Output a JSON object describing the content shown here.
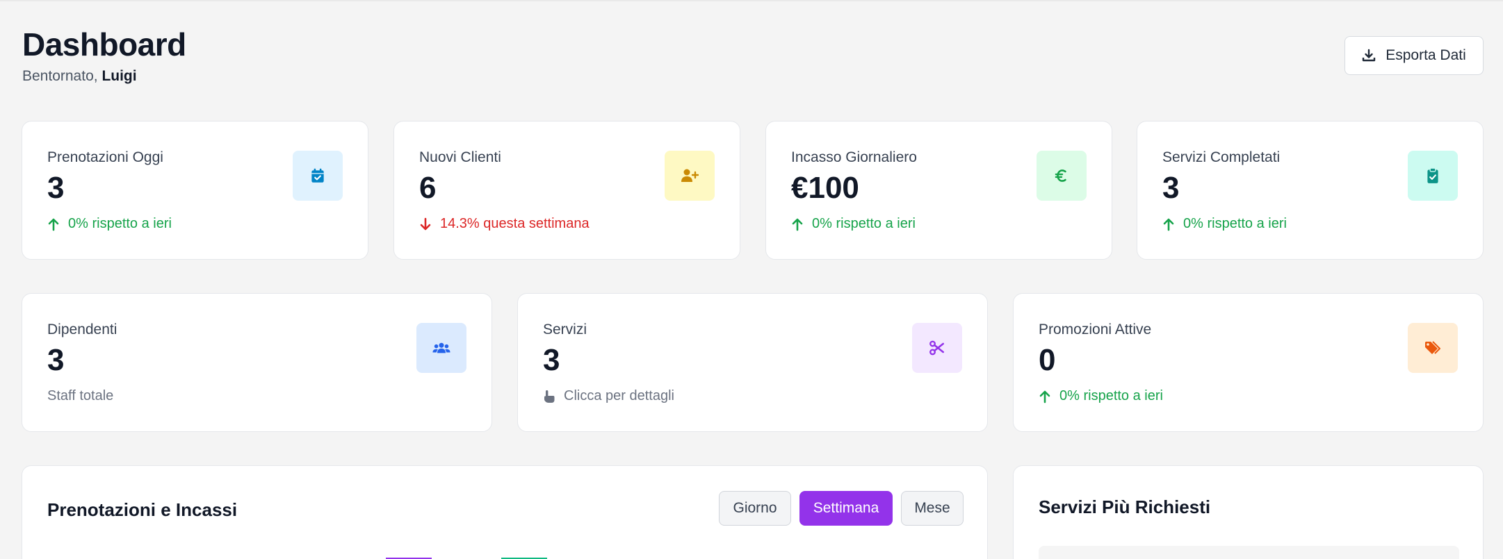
{
  "header": {
    "title": "Dashboard",
    "greeting": "Bentornato,",
    "user_name": "Luigi",
    "export_label": "Esporta Dati"
  },
  "stats_row1": [
    {
      "label": "Prenotazioni Oggi",
      "value": "3",
      "trend": "up",
      "trend_text": "0% rispetto a ieri",
      "icon": "calendar-check-icon",
      "icon_bg": "#e0f2fe",
      "icon_color": "#0284c7"
    },
    {
      "label": "Nuovi Clienti",
      "value": "6",
      "trend": "down",
      "trend_text": "14.3% questa settimana",
      "icon": "user-plus-icon",
      "icon_bg": "#fef9c3",
      "icon_color": "#ca8a04"
    },
    {
      "label": "Incasso Giornaliero",
      "value": "€100",
      "trend": "up",
      "trend_text": "0% rispetto a ieri",
      "icon": "euro-icon",
      "icon_bg": "#dcfce7",
      "icon_color": "#16a34a"
    },
    {
      "label": "Servizi Completati",
      "value": "3",
      "trend": "up",
      "trend_text": "0% rispetto a ieri",
      "icon": "clipboard-check-icon",
      "icon_bg": "#ccfbf1",
      "icon_color": "#0d9488"
    }
  ],
  "stats_row2": [
    {
      "label": "Dipendenti",
      "value": "3",
      "foot_text": "Staff totale",
      "icon": "users-icon",
      "icon_bg": "#dbeafe",
      "icon_color": "#2563eb"
    },
    {
      "label": "Servizi",
      "value": "3",
      "foot_text": "Clicca per dettagli",
      "icon": "scissors-icon",
      "icon_bg": "#f3e8ff",
      "icon_color": "#9333ea"
    },
    {
      "label": "Promozioni Attive",
      "value": "0",
      "trend": "up",
      "trend_text": "0% rispetto a ieri",
      "icon": "tags-icon",
      "icon_bg": "#ffedd5",
      "icon_color": "#ea580c"
    }
  ],
  "chart_panel": {
    "title": "Prenotazioni e Incassi",
    "periods": [
      "Giorno",
      "Settimana",
      "Mese"
    ],
    "active_period": "Settimana",
    "legend_colors": [
      "#9333ea",
      "#10b981"
    ]
  },
  "services_panel": {
    "title": "Servizi Più Richiesti"
  },
  "colors": {
    "accent": "#9333ea",
    "up": "#16a34a",
    "down": "#dc2626"
  }
}
